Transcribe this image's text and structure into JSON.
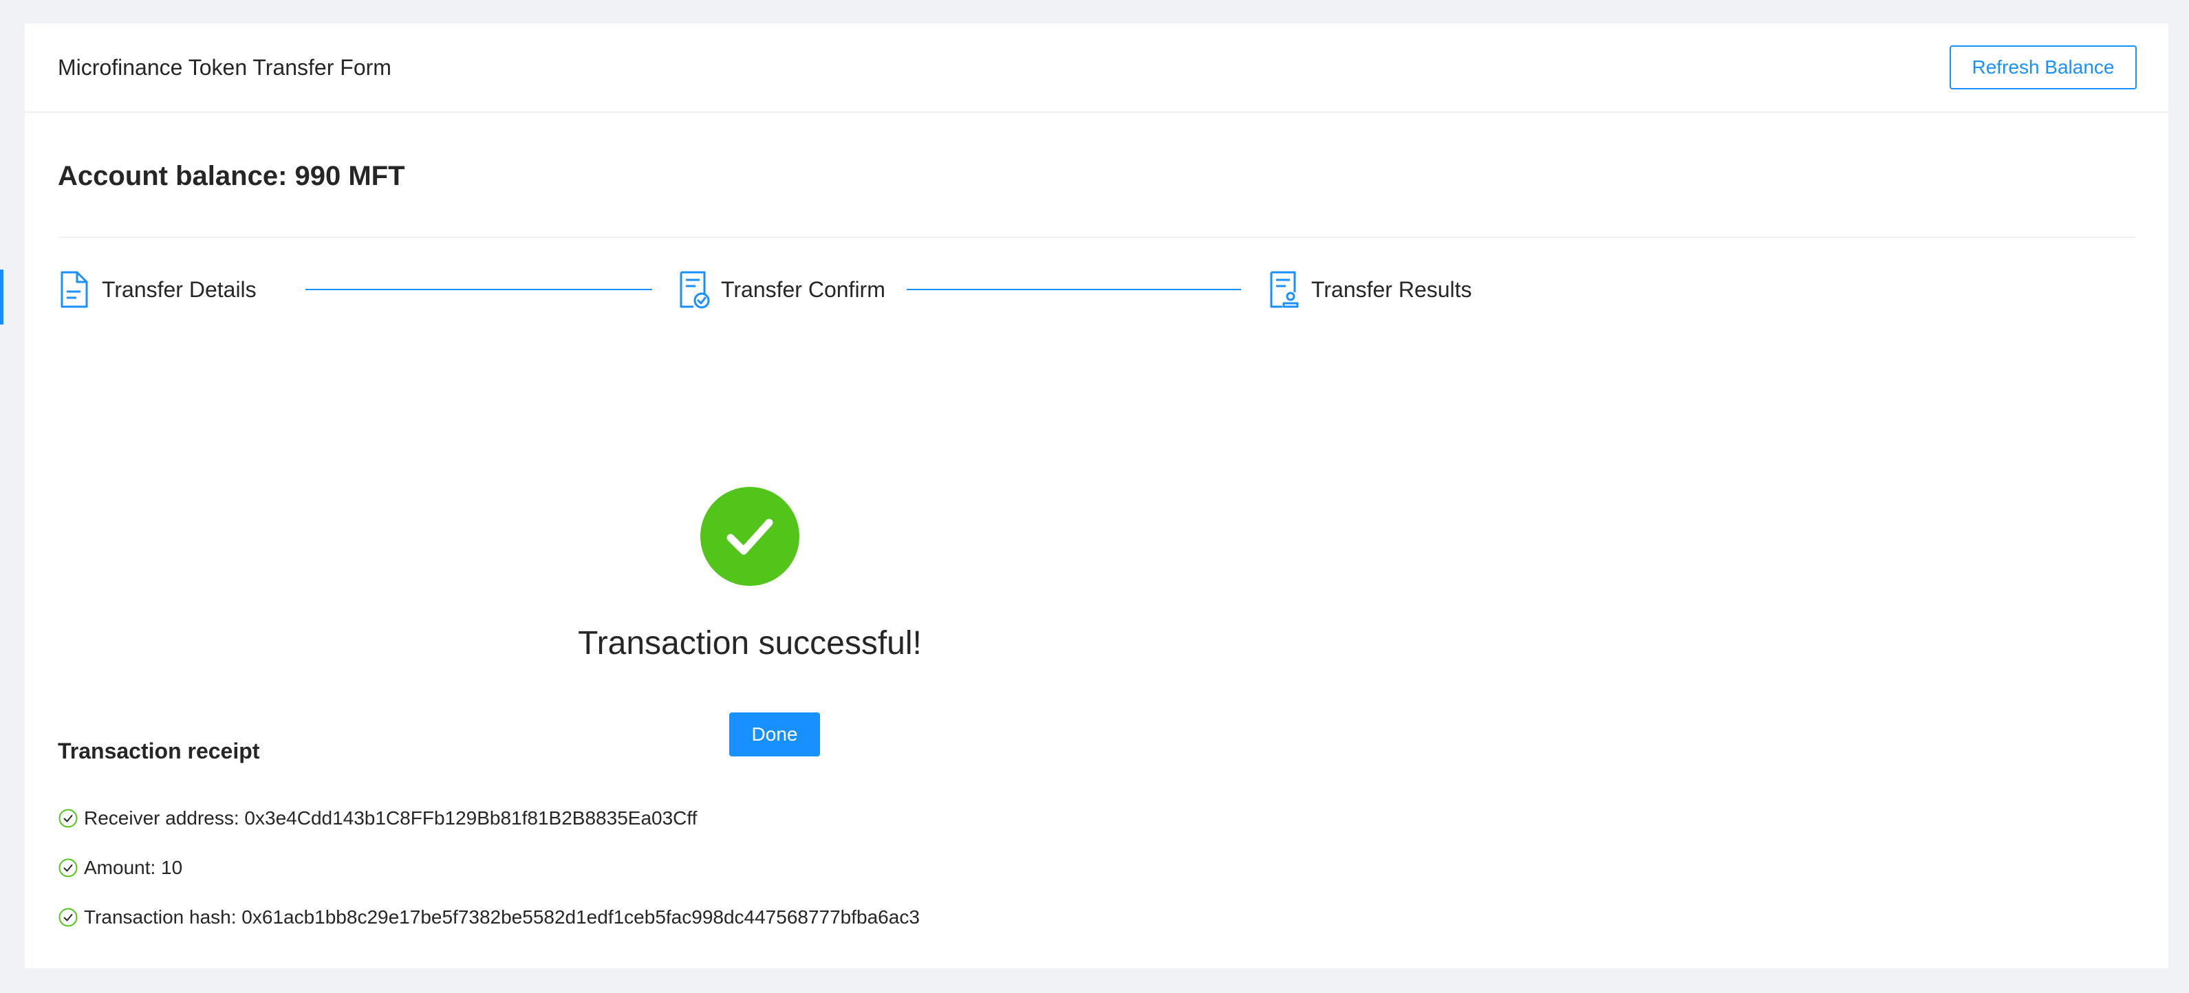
{
  "header": {
    "title": "Microfinance Token Transfer Form",
    "refresh_label": "Refresh Balance"
  },
  "balance": {
    "text": "Account balance: 990 MFT"
  },
  "steps": [
    {
      "label": "Transfer Details",
      "icon": "document-icon",
      "status": "finished"
    },
    {
      "label": "Transfer Confirm",
      "icon": "document-check-icon",
      "status": "finished"
    },
    {
      "label": "Transfer Results",
      "icon": "document-user-icon",
      "status": "current"
    }
  ],
  "result": {
    "title": "Transaction successful!",
    "done_label": "Done",
    "icon": "check-circle-icon"
  },
  "receipt": {
    "title": "Transaction receipt",
    "items": [
      {
        "text": "Receiver address: 0x3e4Cdd143b1C8FFb129Bb81f81B2B8835Ea03Cff"
      },
      {
        "text": "Amount: 10"
      },
      {
        "text": "Transaction hash: 0x61acb1bb8c29e17be5f7382be5582d1edf1ceb5fac998dc447568777bfba6ac3"
      }
    ]
  },
  "colors": {
    "primary": "#1890ff",
    "success": "#52c41a",
    "background": "#f0f2f5",
    "card": "#ffffff",
    "text": "#262626"
  }
}
